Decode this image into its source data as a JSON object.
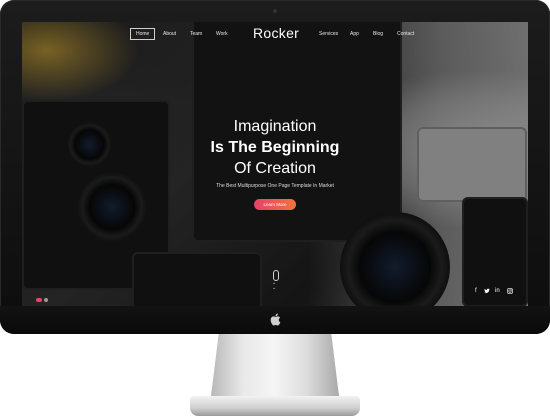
{
  "nav": {
    "left_items": [
      "Home",
      "About",
      "Team",
      "Work"
    ],
    "right_items": [
      "Services",
      "App",
      "Blog",
      "Contact"
    ],
    "logo": "Rocker"
  },
  "hero": {
    "line1": "Imagination",
    "line2": "Is The Beginning",
    "line3": "Of Creation",
    "subtitle": "The Best Multipurpose One Page Template In Market",
    "cta": "Learn More"
  },
  "social": [
    "facebook-icon",
    "twitter-icon",
    "linkedin-icon",
    "instagram-icon"
  ],
  "colors": {
    "accent_start": "#e6426b",
    "accent_end": "#f0743b",
    "bezel": "#111111"
  }
}
